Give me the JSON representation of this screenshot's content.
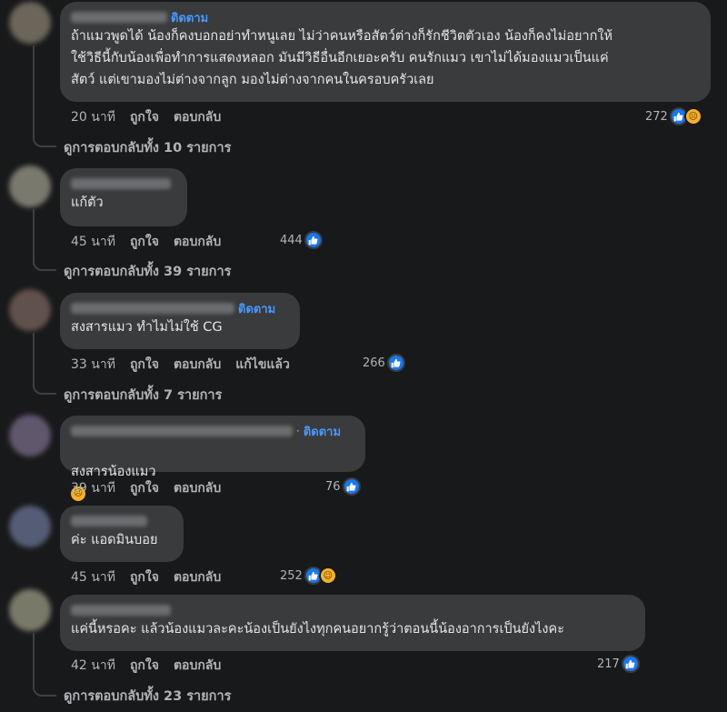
{
  "comments": [
    {
      "text": "ถ้าแมวพูดได้ น้องก็คงบอกอย่าทำหนูเลย ไม่ว่าคนหรือสัตว์ต่างก็รักชีวิตตัวเอง น้องก็คงไม่อยากให้\nใช้วิธีนี้กับน้องเพื่อทำการแสดงหลอก มันมีวิธีอื่นอีกเยอะครับ คนรักแมว เขาไม่ได้มองแมวเป็นแค่\nสัตว์ แต่เขามองไม่ต่างจากลูก มองไม่ต่างจากคนในครอบครัวเลย",
      "follow": "ติดตาม",
      "time": "20 นาที",
      "like": "ถูกใจ",
      "reply": "ตอบกลับ",
      "reactions": "272",
      "view_replies": "ดูการตอบกลับทั้ง 10 รายการ"
    },
    {
      "text": "แก้ตัว",
      "time": "45 นาที",
      "like": "ถูกใจ",
      "reply": "ตอบกลับ",
      "reactions": "444",
      "view_replies": "ดูการตอบกลับทั้ง 39 รายการ"
    },
    {
      "text": "สงสารแมว ทำไมไม่ใช้ CG",
      "follow": "ติดตาม",
      "time": "33 นาที",
      "like": "ถูกใจ",
      "reply": "ตอบกลับ",
      "edited": "แก้ไขแล้ว",
      "reactions": "266",
      "view_replies": "ดูการตอบกลับทั้ง 7 รายการ"
    },
    {
      "text": "สงสารน้องแมว",
      "follow": "ติดตาม",
      "sep": "·",
      "time": "39 นาที",
      "like": "ถูกใจ",
      "reply": "ตอบกลับ",
      "reactions": "76"
    },
    {
      "text": "ค่ะ แอดมินบอย",
      "time": "45 นาที",
      "like": "ถูกใจ",
      "reply": "ตอบกลับ",
      "reactions": "252"
    },
    {
      "text": "แค่นี้หรอคะ แล้วน้องแมวละคะน้องเป็นยังไงทุกคนอยากรู้ว่าตอนนี้น้องอาการเป็นยังไงคะ",
      "time": "42 นาที",
      "like": "ถูกใจ",
      "reply": "ตอบกลับ",
      "reactions": "217",
      "view_replies": "ดูการตอบกลับทั้ง 23 รายการ"
    }
  ],
  "colors": {
    "background": "#18191a",
    "bubble": "#3a3b3c",
    "link": "#4599ff",
    "like": "#1877f2"
  },
  "icons": {
    "like": "thumbs-up-icon",
    "sad": "sad-face-icon",
    "haha": "laughing-face-icon",
    "crying": "crying-face-icon"
  }
}
